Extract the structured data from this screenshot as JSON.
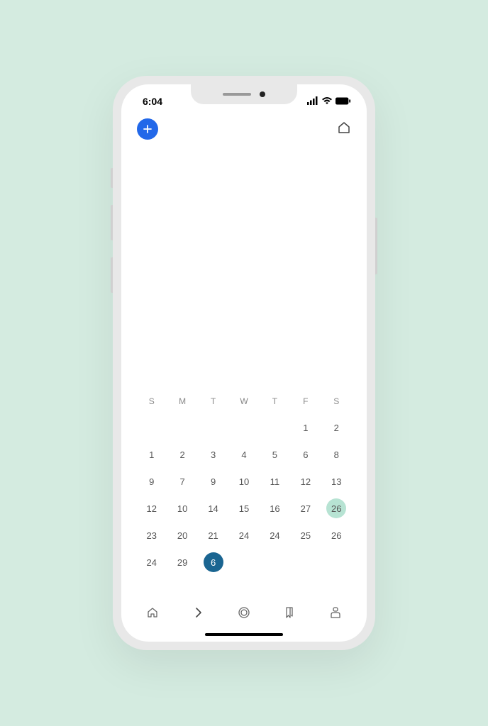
{
  "status": {
    "time": "6:04"
  },
  "calendar": {
    "weekdays": [
      "S",
      "M",
      "T",
      "W",
      "T",
      "F",
      "S"
    ],
    "rows": [
      [
        "",
        "",
        "",
        "",
        "",
        "1",
        "2"
      ],
      [
        "1",
        "2",
        "3",
        "4",
        "5",
        "6",
        "8"
      ],
      [
        "9",
        "7",
        "9",
        "10",
        "11",
        "12",
        "13"
      ],
      [
        "12",
        "10",
        "14",
        "15",
        "16",
        "27",
        "26"
      ],
      [
        "23",
        "20",
        "21",
        "24",
        "24",
        "25",
        "26"
      ],
      [
        "24",
        "29",
        "6",
        "",
        "",
        "",
        ""
      ]
    ],
    "highlighted": {
      "row": 3,
      "col": 6
    },
    "selected": {
      "row": 5,
      "col": 2
    }
  }
}
